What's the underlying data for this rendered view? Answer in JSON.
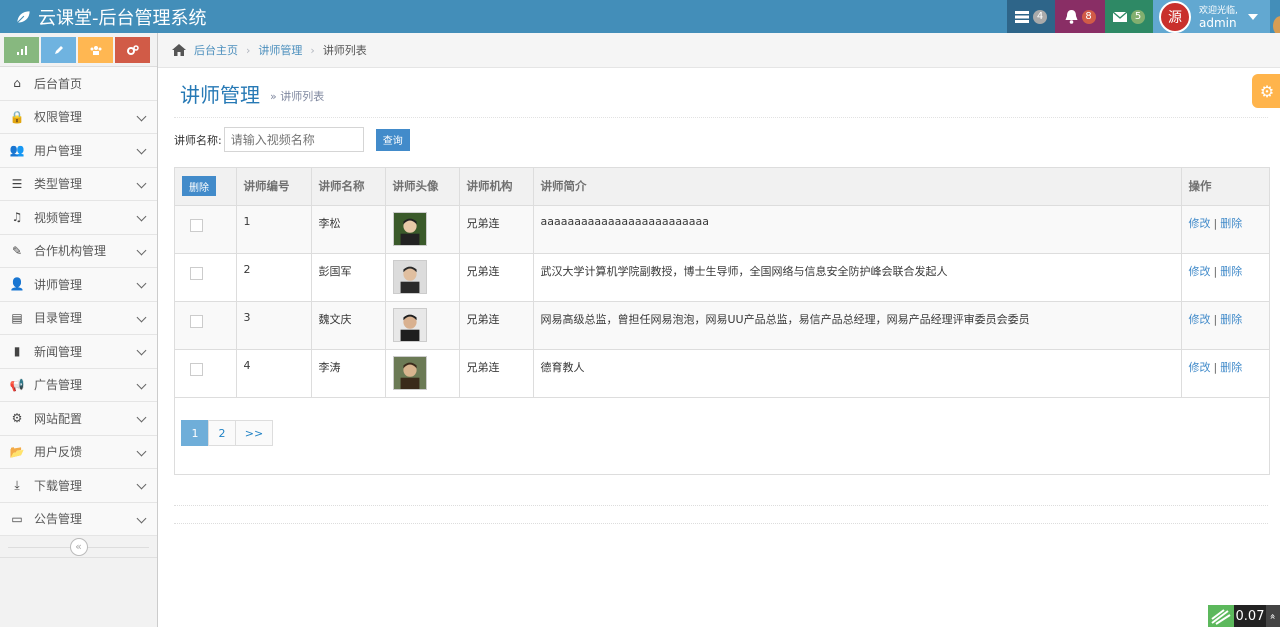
{
  "app": {
    "title": "云课堂-后台管理系统"
  },
  "navbar": {
    "tasks_count": "4",
    "notifications_count": "8",
    "messages_count": "5",
    "avatar_text": "源",
    "welcome": "欢迎光临,",
    "username": "admin"
  },
  "sidebar": {
    "items": [
      {
        "label": "后台首页",
        "icon": "home-icon",
        "glyph": "⌂",
        "expandable": false
      },
      {
        "label": "权限管理",
        "icon": "lock-icon",
        "glyph": "🔒",
        "expandable": true
      },
      {
        "label": "用户管理",
        "icon": "users-icon",
        "glyph": "👥",
        "expandable": true
      },
      {
        "label": "类型管理",
        "icon": "list-icon",
        "glyph": "☰",
        "expandable": true
      },
      {
        "label": "视频管理",
        "icon": "music-icon",
        "glyph": "♫",
        "expandable": true
      },
      {
        "label": "合作机构管理",
        "icon": "edit-icon",
        "glyph": "✎",
        "expandable": true
      },
      {
        "label": "讲师管理",
        "icon": "user-icon",
        "glyph": "👤",
        "expandable": true
      },
      {
        "label": "目录管理",
        "icon": "list-alt-icon",
        "glyph": "▤",
        "expandable": true
      },
      {
        "label": "新闻管理",
        "icon": "file-icon",
        "glyph": "▮",
        "expandable": true
      },
      {
        "label": "广告管理",
        "icon": "bullhorn-icon",
        "glyph": "📢",
        "expandable": true
      },
      {
        "label": "网站配置",
        "icon": "cogs-icon",
        "glyph": "⚙",
        "expandable": true
      },
      {
        "label": "用户反馈",
        "icon": "folder-open-icon",
        "glyph": "📂",
        "expandable": true
      },
      {
        "label": "下载管理",
        "icon": "download-icon",
        "glyph": "⤓",
        "expandable": true
      },
      {
        "label": "公告管理",
        "icon": "credit-card-icon",
        "glyph": "▭",
        "expandable": true
      }
    ],
    "collapse_glyph": "«"
  },
  "breadcrumb": {
    "home": "后台主页",
    "section": "讲师管理",
    "current": "讲师列表"
  },
  "page_header": {
    "title": "讲师管理",
    "subtitle": "» 讲师列表"
  },
  "search": {
    "label": "讲师名称:",
    "placeholder": "请输入视频名称",
    "button": "查询"
  },
  "table": {
    "delete_button": "删除",
    "columns": [
      "讲师编号",
      "讲师名称",
      "讲师头像",
      "讲师机构",
      "讲师简介",
      "操作"
    ],
    "rows": [
      {
        "id": "1",
        "name": "李松",
        "org": "兄弟连",
        "intro": "aaaaaaaaaaaaaaaaaaaaaaaaa",
        "edit": "修改",
        "delete": "删除"
      },
      {
        "id": "2",
        "name": "彭国军",
        "org": "兄弟连",
        "intro": "武汉大学计算机学院副教授，博士生导师，全国网络与信息安全防护峰会联合发起人",
        "edit": "修改",
        "delete": "删除"
      },
      {
        "id": "3",
        "name": "魏文庆",
        "org": "兄弟连",
        "intro": "网易高级总监，曾担任网易泡泡，网易UU产品总监，易信产品总经理，网易产品经理评审委员会委员",
        "edit": "修改",
        "delete": "删除"
      },
      {
        "id": "4",
        "name": "李涛",
        "org": "兄弟连",
        "intro": "德育教人",
        "edit": "修改",
        "delete": "删除"
      }
    ]
  },
  "pagination": {
    "pages": [
      "1",
      "2"
    ],
    "next": ">>",
    "active": "1"
  },
  "footer_widget": {
    "value": "0.07",
    "up_glyph": "»"
  },
  "colors": {
    "navbar": "#438eb9",
    "link": "#428bca",
    "header_title": "#2679b5"
  }
}
